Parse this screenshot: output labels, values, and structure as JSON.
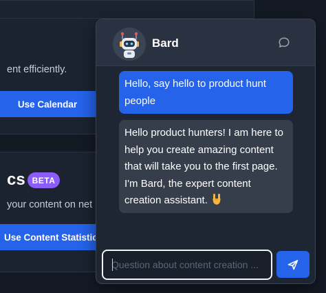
{
  "background": {
    "card_top": {
      "text_efficient": "ent efficiently.",
      "calendar_button_label": "Use Calendar"
    },
    "card_bottom": {
      "heading": "cs",
      "beta_badge": "BETA",
      "text_network": "your content on net",
      "stats_button_label": "Use Content Statistics"
    }
  },
  "chat": {
    "bot_name": "Bard",
    "avatar_icon": "robot-avatar-icon",
    "header_icon": "chat-bubble-icon",
    "messages": [
      {
        "role": "user",
        "text": "Hello, say hello to product hunt people"
      },
      {
        "role": "bot",
        "text": "Hello product hunters! I am here to help you create amazing content that will take you to the first page. I'm Bard, the expert content creation assistant. ",
        "emoji": "rock-on-hand-emoji"
      }
    ],
    "input": {
      "placeholder": "Question about content creation ...",
      "value": ""
    },
    "send_icon": "send-paper-plane-icon"
  },
  "colors": {
    "page_bg": "#141a24",
    "card_bg": "#1c2330",
    "accent_blue": "#2563eb",
    "beta_purple": "#8b5cf6",
    "bot_bubble": "#363e4c",
    "panel_bg": "#1f2633"
  }
}
